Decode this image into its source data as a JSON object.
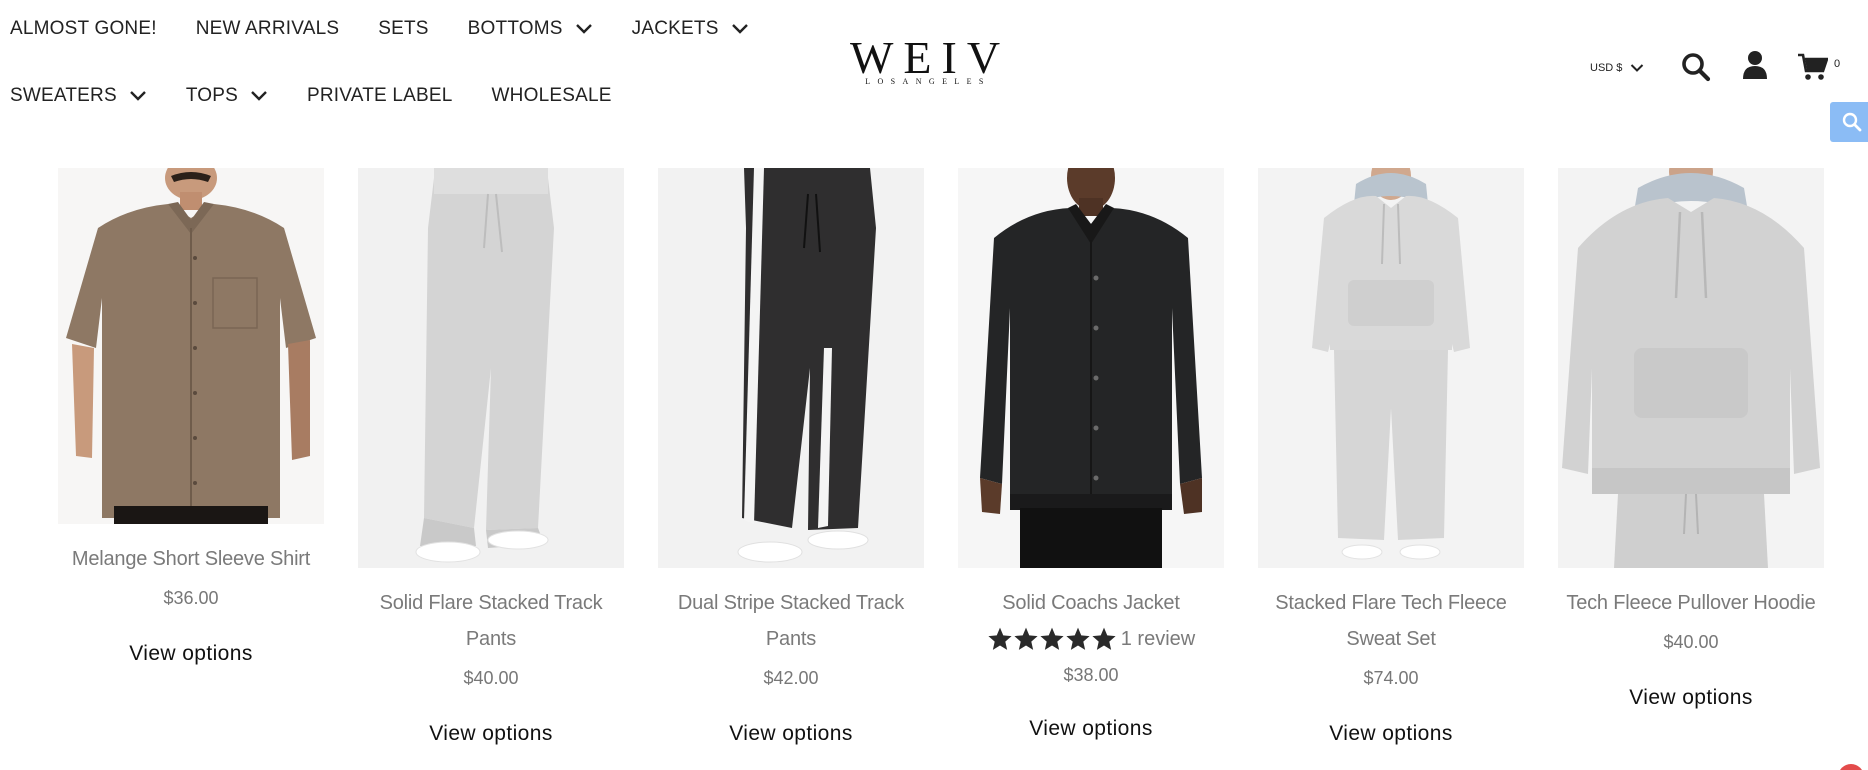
{
  "nav": {
    "row1": [
      {
        "label": "ALMOST GONE!",
        "has_dropdown": false
      },
      {
        "label": "NEW ARRIVALS",
        "has_dropdown": false
      },
      {
        "label": "SETS",
        "has_dropdown": false
      },
      {
        "label": "BOTTOMS",
        "has_dropdown": true
      },
      {
        "label": "JACKETS",
        "has_dropdown": true
      }
    ],
    "row2": [
      {
        "label": "SWEATERS",
        "has_dropdown": true
      },
      {
        "label": "TOPS",
        "has_dropdown": true
      },
      {
        "label": "PRIVATE LABEL",
        "has_dropdown": false
      },
      {
        "label": "WHOLESALE",
        "has_dropdown": false
      }
    ]
  },
  "logo": {
    "main": "WEIV",
    "sub": "LOSANGELES"
  },
  "header": {
    "currency": "USD $",
    "cart_count": "0",
    "icons": [
      "search-icon",
      "user-icon",
      "cart-icon",
      "chevron-down-icon"
    ]
  },
  "side_search": {
    "icon": "search-icon",
    "color": "#8bbcf5"
  },
  "products": [
    {
      "title": "Melange Short Sleeve Shirt",
      "price": "$36.00",
      "button": "View options"
    },
    {
      "title": "Solid Flare Stacked Track Pants",
      "price": "$40.00",
      "button": "View options"
    },
    {
      "title": "Dual Stripe Stacked Track Pants",
      "price": "$42.00",
      "button": "View options"
    },
    {
      "title": "Solid Coachs Jacket",
      "price": "$38.00",
      "button": "View options",
      "rating": 5,
      "review_text": "1 review"
    },
    {
      "title": "Stacked Flare Tech Fleece Sweat Set",
      "price": "$74.00",
      "button": "View options"
    },
    {
      "title": "Tech Fleece Pullover Hoodie",
      "price": "$40.00",
      "button": "View options"
    }
  ],
  "colors": {
    "text": "#222222",
    "muted": "#7a7a7a",
    "accent_blue": "#8bbcf5"
  }
}
